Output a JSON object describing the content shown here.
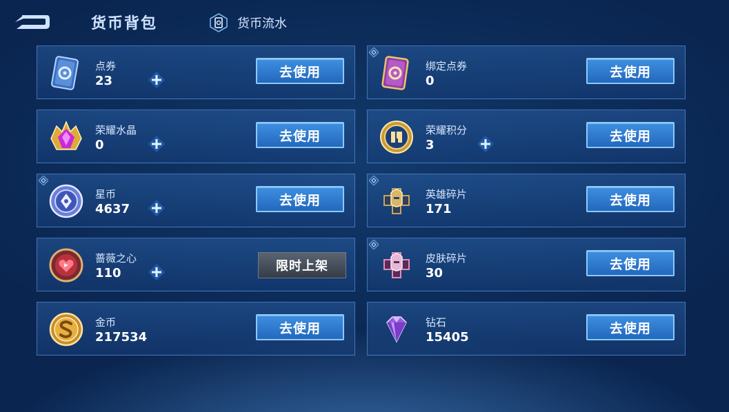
{
  "header": {
    "title": "货币背包",
    "flow_link": "货币流水",
    "back_icon": "back-arrow-icon"
  },
  "colors": {
    "accent": "#2f7fd6",
    "button_border": "#8ccaff",
    "background": "#0d2e5c"
  },
  "currencies": [
    {
      "name": "点券",
      "value": "23",
      "icon": "ticket-blue-icon",
      "button": "去使用",
      "has_plus": true,
      "bound": false
    },
    {
      "name": "绑定点券",
      "value": "0",
      "icon": "ticket-purple-icon",
      "button": "去使用",
      "has_plus": false,
      "bound": true
    },
    {
      "name": "荣耀水晶",
      "value": "0",
      "icon": "crystal-icon",
      "button": "去使用",
      "has_plus": true,
      "bound": false
    },
    {
      "name": "荣耀积分",
      "value": "3",
      "icon": "points-coin-icon",
      "button": "去使用",
      "has_plus": true,
      "bound": false
    },
    {
      "name": "星币",
      "value": "4637",
      "icon": "star-coin-icon",
      "button": "去使用",
      "has_plus": true,
      "bound": true
    },
    {
      "name": "英雄碎片",
      "value": "171",
      "icon": "hero-fragment-icon",
      "button": "去使用",
      "has_plus": false,
      "bound": true
    },
    {
      "name": "蔷薇之心",
      "value": "110",
      "icon": "rose-heart-icon",
      "button": "限时上架",
      "has_plus": true,
      "bound": false
    },
    {
      "name": "皮肤碎片",
      "value": "30",
      "icon": "skin-fragment-icon",
      "button": "去使用",
      "has_plus": false,
      "bound": true
    },
    {
      "name": "金币",
      "value": "217534",
      "icon": "gold-coin-icon",
      "button": "去使用",
      "has_plus": false,
      "bound": false
    },
    {
      "name": "钻石",
      "value": "15405",
      "icon": "diamond-icon",
      "button": "去使用",
      "has_plus": false,
      "bound": false
    }
  ]
}
